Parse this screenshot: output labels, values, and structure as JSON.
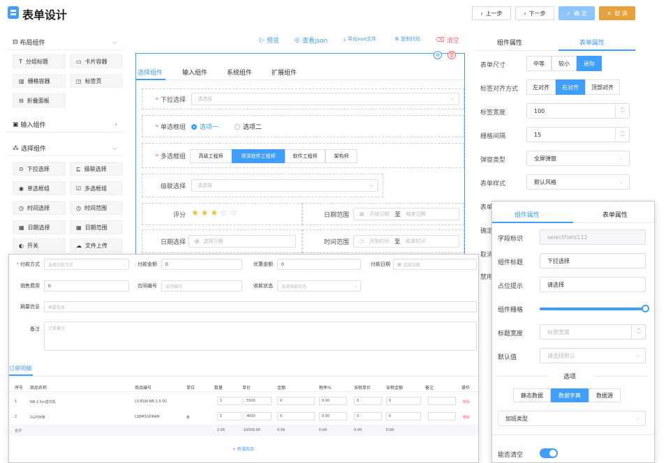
{
  "header": {
    "title": "表单设计",
    "prev_label": "上一步",
    "next_label": "下一步",
    "confirm_label": "确 定",
    "cancel_label": "取 消"
  },
  "palette": {
    "groups": [
      {
        "title": "布局组件",
        "items": [
          "分组标题",
          "卡片容器",
          "栅格容器",
          "标签页",
          "折叠面板"
        ]
      },
      {
        "title": "输入组件",
        "items": []
      },
      {
        "title": "选择组件",
        "items": [
          "下拉选择",
          "级联选择",
          "单选框组",
          "多选框组",
          "时间选择",
          "时间范围",
          "日期选择",
          "日期范围",
          "开关",
          "文件上传"
        ]
      }
    ]
  },
  "toolbar": {
    "preview": "预览",
    "view_json": "查看json",
    "export_vue": "导出vue文件",
    "copy_code": "复制代码",
    "clear": "清空"
  },
  "canvas": {
    "tabs": [
      "选择组件",
      "输入组件",
      "系统组件",
      "扩展组件"
    ],
    "select_label": "下拉选择",
    "select_placeholder": "请选择",
    "radio_label": "单选框组",
    "radio_options": [
      "选项一",
      "选项二"
    ],
    "checkbox_label": "多选框组",
    "checkbox_options": [
      "高级工程师",
      "资深软件工程师",
      "软件工程师",
      "架构师"
    ],
    "cascade_label": "级联选择",
    "cascade_placeholder": "请选择",
    "rate_label": "评分",
    "rate_value": 3,
    "rate_max": 5,
    "daterange_label": "日期范围",
    "start_date": "开始日期",
    "to": "至",
    "end_date": "结束日期",
    "date_label": "日期选择",
    "date_placeholder": "选择日期",
    "timerange_label": "时间范围",
    "start_time": "开始时间",
    "end_time": "结束时间"
  },
  "props": {
    "tab_component": "组件属性",
    "tab_form": "表单属性",
    "size_label": "表单尺寸",
    "size_options": [
      "中等",
      "较小",
      "迷你"
    ],
    "align_label": "标签对齐方式",
    "align_options": [
      "左对齐",
      "右对齐",
      "顶部对齐"
    ],
    "label_width_label": "标签宽度",
    "label_width": "100",
    "gutter_label": "栅格间隔",
    "gutter": "15",
    "dialog_label": "弹窗类型",
    "dialog_value": "全屏弹窗",
    "style_label": "表单样式",
    "style_value": "默认风格",
    "hidden_labels": [
      "表单",
      "确定",
      "取消",
      "禁用"
    ]
  },
  "order_form": {
    "pay_method_label": "付款方式",
    "pay_method_ph": "选择付款方式",
    "pay_amount_label": "付款金额",
    "pay_amount": "0",
    "discount_label": "优惠金额",
    "discount": "0",
    "pay_date_label": "付款日期",
    "pay_date_ph": "选择日期",
    "sales_fee_label": "销售费用",
    "sales_fee": "0",
    "contract_label": "合同编号",
    "contract_ph": "合同编号",
    "receipt_label": "收款状态",
    "receipt_ph": "选择收款状态",
    "summary_label": "摘要信息",
    "summary_ph": "摘要信息",
    "remark_label": "备注",
    "remark_ph": "订单备注",
    "detail_title": "订单明细",
    "columns": [
      "序号",
      "商品名称",
      "商品编号",
      "单位",
      "数量",
      "单价",
      "金额",
      "税率%",
      "含税单价",
      "含税金额",
      "备注",
      "操作"
    ],
    "rows": [
      {
        "no": "1",
        "name": "NB-1.5m直饮机",
        "code": "LS-ESW-NB-1.5-DC",
        "unit": "",
        "qty": "1",
        "price": "5500",
        "amount": "0",
        "tax": "0.00",
        "tax_price": "0",
        "tax_amount": "0",
        "remark": "",
        "op": "删除"
      },
      {
        "no": "2",
        "name": "1G内存条",
        "code": "LSBM1GDRAM",
        "unit": "条",
        "qty": "1",
        "price": "4000",
        "amount": "0",
        "tax": "0.00",
        "tax_price": "0",
        "tax_amount": "0",
        "remark": "",
        "op": "删除"
      }
    ],
    "total_label": "合计",
    "totals": [
      "2.00",
      "10500.00",
      "0.00",
      "0.00",
      "0.00",
      "0.00"
    ],
    "add_label": "+ 新增商品"
  },
  "field_props": {
    "tab_component": "组件属性",
    "tab_form": "表单属性",
    "field_id_label": "字段标识",
    "field_id": "selectField112",
    "title_label": "组件标题",
    "title": "下拉选择",
    "placeholder_label": "占位提示",
    "placeholder": "请选择",
    "grid_label": "组件栅格",
    "grid_value": 1.0,
    "label_width_label": "标题宽度",
    "label_width_ph": "标题宽度",
    "default_label": "默认值",
    "default_ph": "请选择默认",
    "options_title": "选项",
    "source_options": [
      "静态数据",
      "数据字典",
      "数据源"
    ],
    "dict_value": "加班类型",
    "clearable_label": "能否清空",
    "clearable": true
  },
  "colors": {
    "primary": "#409eff",
    "danger": "#f56c6c",
    "warning": "#e6a23c",
    "star": "#f7ba2a"
  }
}
